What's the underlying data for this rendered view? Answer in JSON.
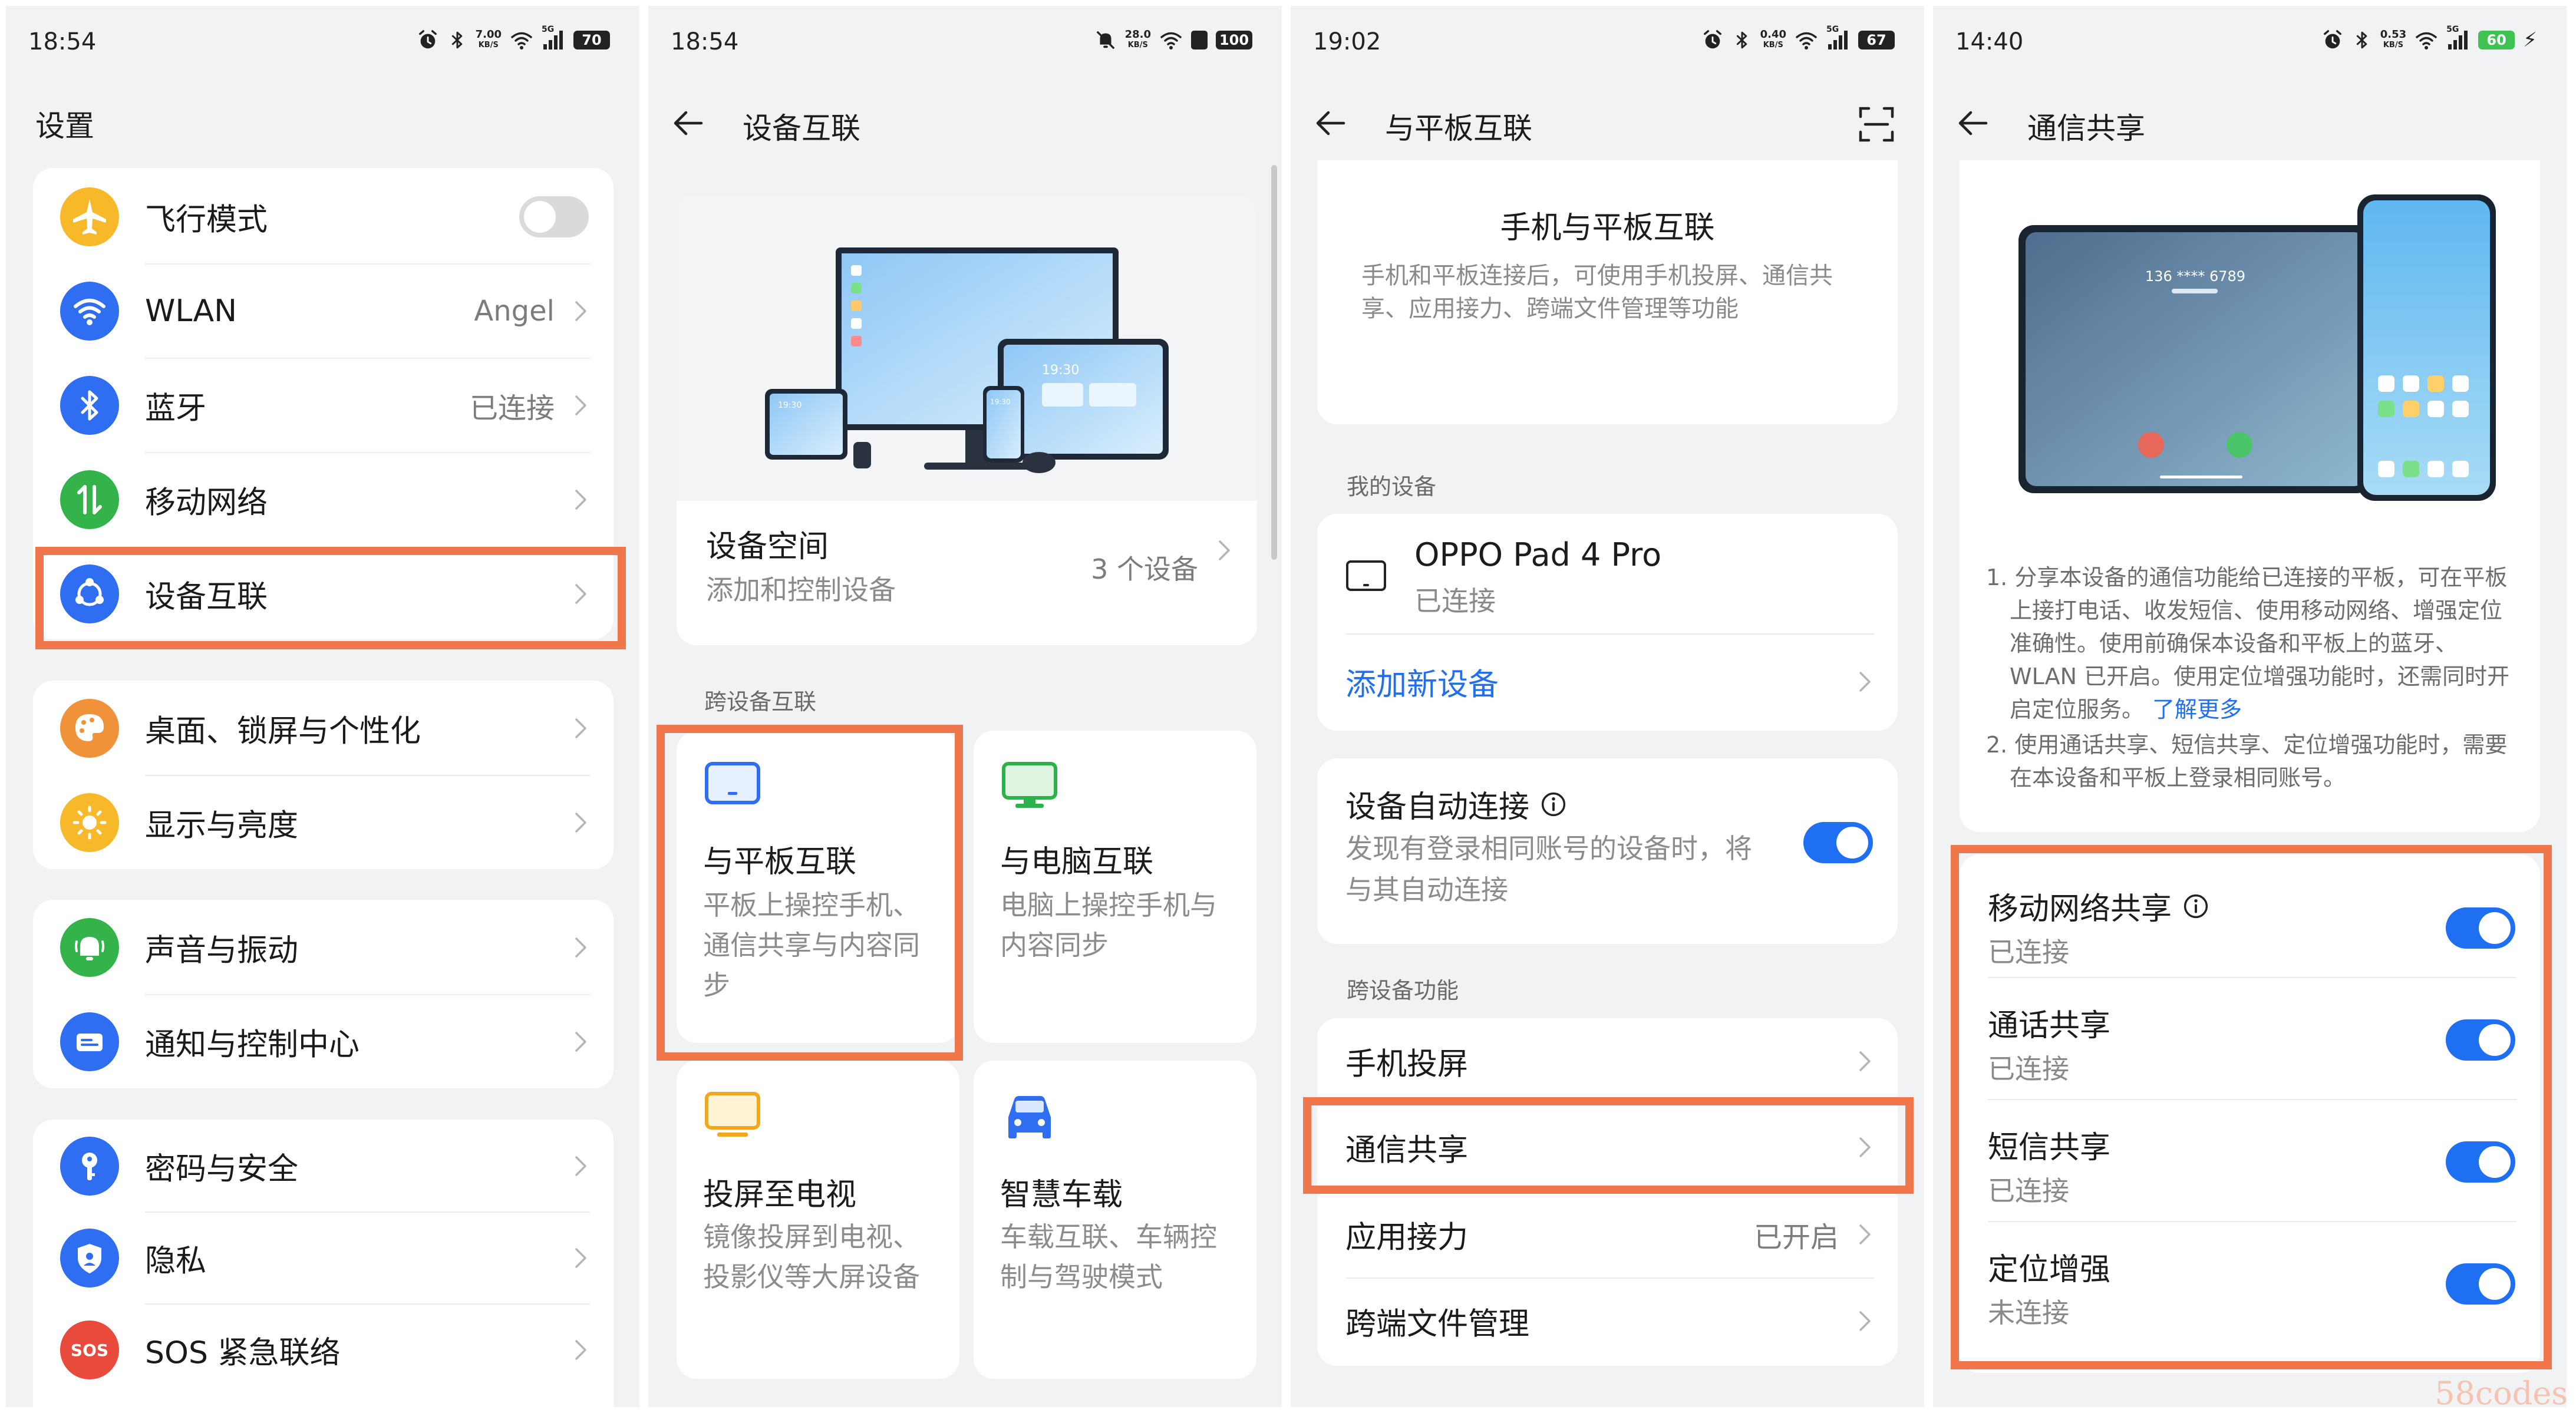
{
  "panel1": {
    "status": {
      "time": "18:54",
      "net_speed": "7.00",
      "net_unit": "KB/S",
      "signal": "5G",
      "battery": "70"
    },
    "title": "设置",
    "items": [
      {
        "label": "飞行模式",
        "icon": "airplane-icon",
        "toggle": "off"
      },
      {
        "label": "WLAN",
        "value": "Angel",
        "icon": "wifi-icon"
      },
      {
        "label": "蓝牙",
        "value": "已连接",
        "icon": "bluetooth-icon"
      },
      {
        "label": "移动网络",
        "icon": "mobile-network-icon"
      },
      {
        "label": "设备互联",
        "icon": "device-connect-icon"
      },
      {
        "label": "桌面、锁屏与个性化",
        "icon": "palette-icon"
      },
      {
        "label": "显示与亮度",
        "icon": "sun-icon"
      },
      {
        "label": "声音与振动",
        "icon": "bell-icon"
      },
      {
        "label": "通知与控制中心",
        "icon": "notification-icon"
      },
      {
        "label": "密码与安全",
        "icon": "key-icon"
      },
      {
        "label": "隐私",
        "icon": "privacy-icon"
      },
      {
        "label": "SOS 紧急联络",
        "icon": "sos-icon",
        "icon_text": "SOS"
      }
    ],
    "colors": {
      "blue": "#2f6ef0",
      "green": "#33b34a",
      "orange": "#f0923a",
      "yellow": "#f7b829",
      "red": "#e84b3c",
      "highlight": "#f0764b"
    }
  },
  "panel2": {
    "status": {
      "time": "18:54",
      "net_speed": "28.0",
      "net_unit": "KB/S",
      "battery": "100"
    },
    "title": "设备互联",
    "space": {
      "title": "设备空间",
      "subtitle": "添加和控制设备",
      "count": "3 个设备"
    },
    "illus_times": [
      "19:30",
      "19:30",
      "19:30"
    ],
    "section": "跨设备互联",
    "tiles": [
      {
        "title": "与平板互联",
        "desc": "平板上操控手机、通信共享与内容同步",
        "icon": "tablet-icon"
      },
      {
        "title": "与电脑互联",
        "desc": "电脑上操控手机与内容同步",
        "icon": "monitor-icon"
      },
      {
        "title": "投屏至电视",
        "desc": "镜像投屏到电视、投影仪等大屏设备",
        "icon": "tv-icon"
      },
      {
        "title": "智慧车载",
        "desc": "车载互联、车辆控制与驾驶模式",
        "icon": "car-icon"
      }
    ]
  },
  "panel3": {
    "status": {
      "time": "19:02",
      "net_speed": "0.40",
      "net_unit": "KB/S",
      "signal": "5G",
      "battery": "67"
    },
    "title": "与平板互联",
    "intro": {
      "title": "手机与平板互联",
      "desc": "手机和平板连接后，可使用手机投屏、通信共享、应用接力、跨端文件管理等功能"
    },
    "my_devices_label": "我的设备",
    "device": {
      "name": "OPPO Pad 4 Pro",
      "status": "已连接"
    },
    "add_device": "添加新设备",
    "auto": {
      "title": "设备自动连接",
      "desc": "发现有登录相同账号的设备时，将与其自动连接",
      "toggle": "on"
    },
    "features_label": "跨设备功能",
    "features": [
      {
        "label": "手机投屏"
      },
      {
        "label": "通信共享"
      },
      {
        "label": "应用接力",
        "value": "已开启"
      },
      {
        "label": "跨端文件管理"
      }
    ]
  },
  "panel4": {
    "status": {
      "time": "14:40",
      "net_speed": "0.53",
      "net_unit": "KB/S",
      "signal": "5G",
      "battery": "60"
    },
    "title": "通信共享",
    "phone_number": "136 **** 6789",
    "notes": [
      "1. 分享本设备的通信功能给已连接的平板，可在平板上接打电话、收发短信、使用移动网络、增强定位准确性。使用前确保本设备和平板上的蓝牙、WLAN 已开启。使用定位增强功能时，还需同时开启定位服务。",
      "2. 使用通话共享、短信共享、定位增强功能时，需要在本设备和平板上登录相同账号。"
    ],
    "learn_more": "了解更多",
    "shares": [
      {
        "title": "移动网络共享",
        "status": "已连接",
        "toggle": "on"
      },
      {
        "title": "通话共享",
        "status": "已连接",
        "toggle": "on"
      },
      {
        "title": "短信共享",
        "status": "已连接",
        "toggle": "on"
      },
      {
        "title": "定位增强",
        "status": "未连接",
        "toggle": "on"
      }
    ]
  },
  "watermark": "58codes"
}
